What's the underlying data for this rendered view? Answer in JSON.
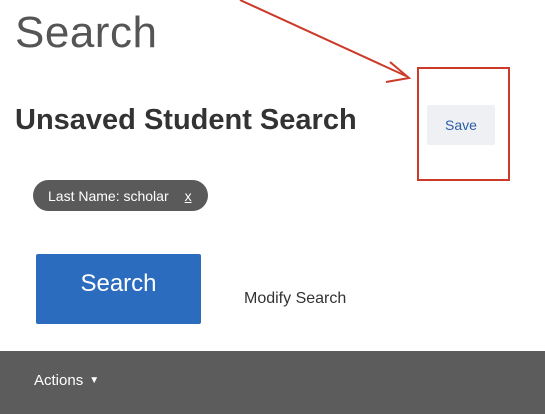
{
  "header": {
    "title": "Search"
  },
  "search": {
    "heading": "Unsaved Student Search",
    "save_label": "Save",
    "filters": [
      {
        "label": "Last Name: scholar",
        "remove_label": "x"
      }
    ],
    "search_button_label": "Search",
    "modify_link_label": "Modify Search"
  },
  "toolbar": {
    "actions_label": "Actions",
    "actions_caret": "▼"
  },
  "annotation": {
    "color": "#cc3a2a",
    "arrow_icon": "pointer-arrow-icon"
  }
}
